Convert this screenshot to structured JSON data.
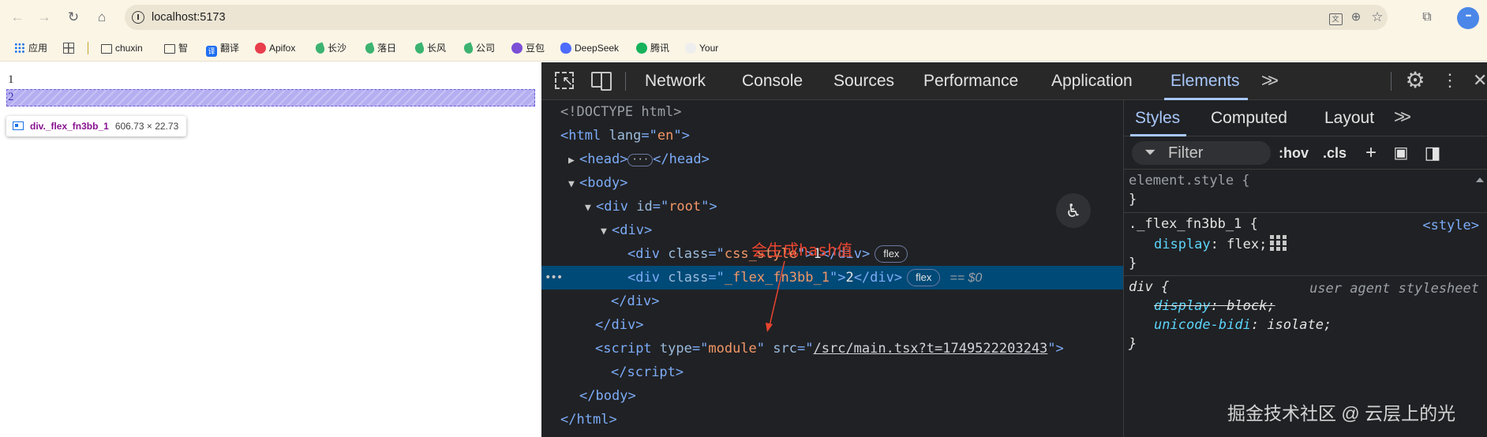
{
  "browser": {
    "url": "localhost:5173",
    "bookmarks": [
      {
        "label": "应用",
        "icon": "apps-icon"
      },
      {
        "label": "",
        "icon": "grid-icon"
      },
      {
        "label": "chuxin",
        "icon": "folder-icon"
      },
      {
        "label": "智",
        "icon": "folder-icon"
      },
      {
        "label": "翻译",
        "icon": "translate-app-icon"
      },
      {
        "label": "Apifox",
        "icon": "apifox-icon"
      },
      {
        "label": "长沙",
        "icon": "leaf-icon"
      },
      {
        "label": "落日",
        "icon": "leaf-icon"
      },
      {
        "label": "长风",
        "icon": "leaf-icon"
      },
      {
        "label": "公司",
        "icon": "leaf-icon"
      },
      {
        "label": "豆包",
        "icon": "doubao-icon"
      },
      {
        "label": "DeepSeek",
        "icon": "deepseek-icon"
      },
      {
        "label": "腾讯",
        "icon": "tencent-icon"
      },
      {
        "label": "Your",
        "icon": "site-icon"
      }
    ]
  },
  "page": {
    "line1": "1",
    "line2": "2",
    "tooltip": {
      "name": "div._flex_fn3bb_1",
      "size": "606.73 × 22.73"
    }
  },
  "devtools": {
    "tabs": [
      "Network",
      "Console",
      "Sources",
      "Performance",
      "Application",
      "Elements"
    ],
    "active_tab": "Elements",
    "dom": {
      "doctype": "<!DOCTYPE html>",
      "html_lang": "en",
      "root_id": "root",
      "div1_class": "css_style",
      "div1_text": "1",
      "div2_class": "_flex_fn3bb_1",
      "div2_text": "2",
      "script_type": "module",
      "script_src": "/src/main.tsx?t=1749522203243",
      "flex_badge": "flex",
      "selected_marker": "== $0",
      "annotation": "会生成hash值"
    },
    "styles_panel": {
      "tabs": [
        "Styles",
        "Computed",
        "Layout"
      ],
      "active_tab": "Styles",
      "filter_placeholder": "Filter",
      "hov": ":hov",
      "cls": ".cls",
      "rules": {
        "element_style": "element.style {",
        "flex_selector": "._flex_fn3bb_1 {",
        "flex_origin": "<style>",
        "flex_prop": "display",
        "flex_val": "flex;",
        "ua_selector": "div {",
        "ua_origin": "user agent stylesheet",
        "ua_prop1": "display",
        "ua_val1": "block;",
        "ua_prop2": "unicode-bidi",
        "ua_val2": "isolate;"
      }
    }
  },
  "watermark": "掘金技术社区 @ 云层上的光",
  "colors": {
    "devtools_bg": "#202124",
    "selection": "#004a77",
    "accent": "#a8c7fa",
    "annotation": "#e8452f",
    "overlay": "#7b6ee6"
  }
}
